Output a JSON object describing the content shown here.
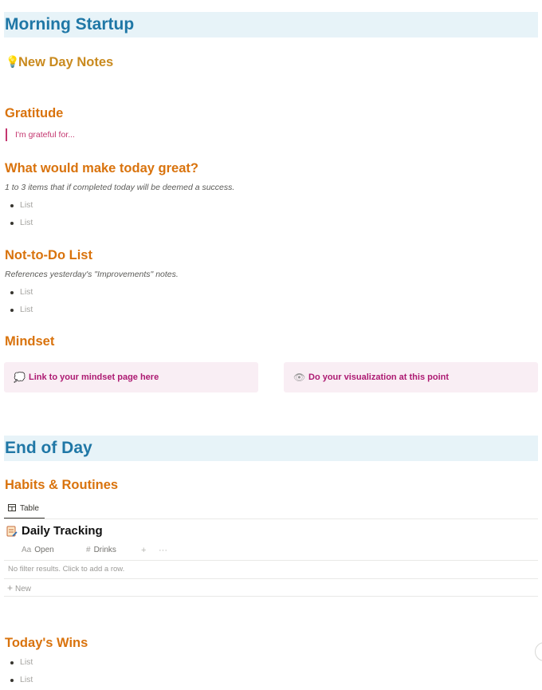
{
  "morning": {
    "title": "Morning Startup"
  },
  "notes": {
    "icon": "lightbulb-icon",
    "title": "New Day Notes"
  },
  "gratitude": {
    "title": "Gratitude",
    "quote": "I'm grateful for..."
  },
  "great": {
    "title": "What would make today great?",
    "description": "1 to 3 items that if completed today will be deemed a success.",
    "items": [
      "List",
      "List"
    ]
  },
  "not_todo": {
    "title": "Not-to-Do List",
    "description": "References yesterday's \"Improvements\" notes.",
    "items": [
      "List",
      "List"
    ]
  },
  "mindset": {
    "title": "Mindset",
    "callouts": [
      {
        "icon": "thought-bubble-icon",
        "text": "Link to your mindset page here"
      },
      {
        "icon": "eye-icon",
        "text": "Do your visualization at this point"
      }
    ]
  },
  "end_of_day": {
    "title": "End of Day"
  },
  "habits": {
    "title": "Habits & Routines",
    "view_tab": {
      "icon": "table-icon",
      "label": "Table"
    },
    "database": {
      "icon": "spreadsheet-icon",
      "title": "Daily Tracking",
      "columns": [
        {
          "symbol": "Aa",
          "label": "Open"
        },
        {
          "symbol": "#",
          "label": "Drinks"
        }
      ],
      "add_column": "+",
      "more": "···",
      "empty_message": "No filter results. Click to add a row.",
      "new_label": "New"
    }
  },
  "wins": {
    "title": "Today's Wins",
    "items": [
      "List",
      "List"
    ]
  },
  "colors": {
    "h1": "#1f77a6",
    "h2": "#d9730d",
    "accent_pink": "#ad1a72"
  }
}
